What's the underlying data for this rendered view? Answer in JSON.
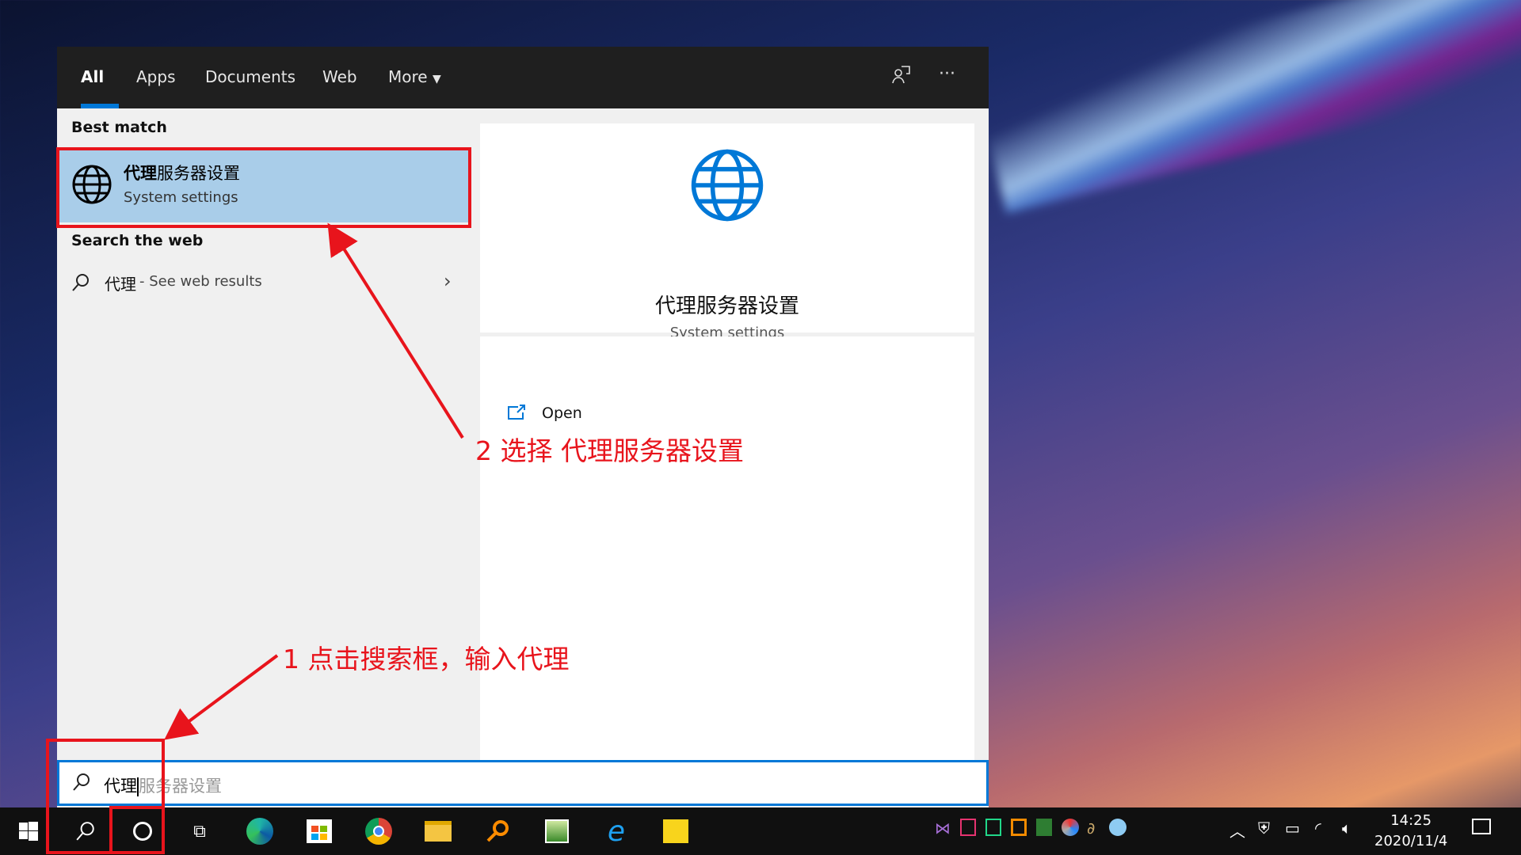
{
  "tabs": [
    {
      "label": "All",
      "active": true
    },
    {
      "label": "Apps"
    },
    {
      "label": "Documents"
    },
    {
      "label": "Web"
    },
    {
      "label": "More"
    }
  ],
  "header_icons": [
    "feedback-icon",
    "more-options-icon"
  ],
  "header_more": "···",
  "left": {
    "best_match_label": "Best match",
    "best_match": {
      "title_bold": "代理",
      "title_rest": "服务器设置",
      "subtitle": "System settings",
      "icon": "globe-icon"
    },
    "search_web_label": "Search the web",
    "web_result": {
      "query": "代理",
      "suffix": " - See web results"
    }
  },
  "preview": {
    "title": "代理服务器设置",
    "subtitle": "System settings",
    "open_label": "Open"
  },
  "search": {
    "typed": "代理",
    "suggestion": "服务器设置"
  },
  "annotations": {
    "step2": "2 选择 代理服务器设置",
    "step1": "1 点击搜索框，输入代理",
    "color": "#e8141c"
  },
  "taskbar": {
    "time": "14:25",
    "date": "2020/11/4"
  },
  "colors": {
    "accent": "#0078d7",
    "highlight": "#a9cde9"
  }
}
